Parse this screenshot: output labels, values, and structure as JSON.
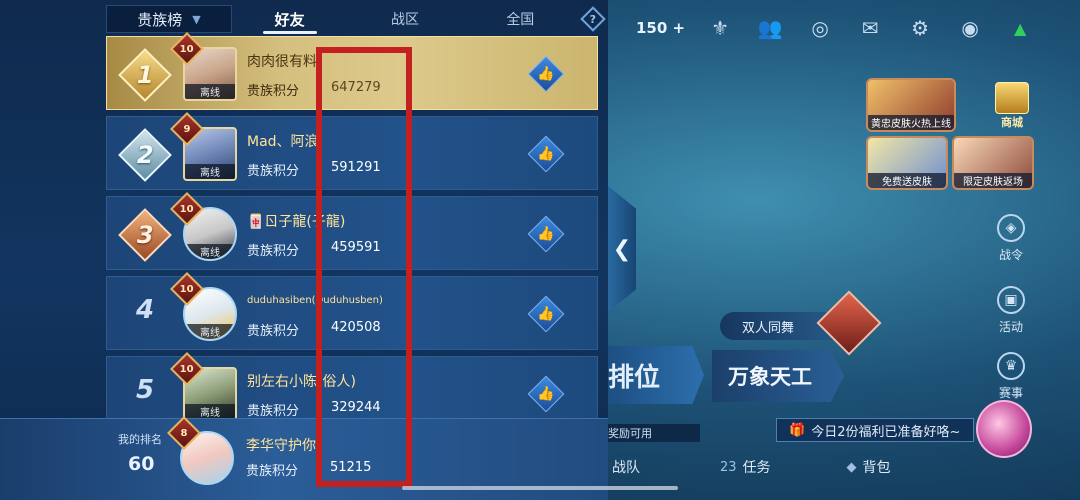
{
  "tabs": {
    "dropdown_label": "贵族榜",
    "friends": "好友",
    "region": "战区",
    "national": "全国",
    "help": "?"
  },
  "rows": [
    {
      "rank": "1",
      "level": "10",
      "name": "肉肉很有料",
      "score_label": "贵族积分",
      "score": "647279",
      "status": "离线"
    },
    {
      "rank": "2",
      "level": "9",
      "name": "Mad、阿浪",
      "score_label": "贵族积分",
      "score": "591291",
      "status": "离线"
    },
    {
      "rank": "3",
      "level": "10",
      "name": "🀄ㄖ子龍(子龍)",
      "score_label": "贵族积分",
      "score": "459591",
      "status": "离线"
    },
    {
      "rank": "4",
      "level": "10",
      "name": "duduhasiben(Duduhusben)",
      "score_label": "贵族积分",
      "score": "420508",
      "status": "离线"
    },
    {
      "rank": "5",
      "level": "10",
      "name": "别左右小陈(俗人)",
      "score_label": "贵族积分",
      "score": "329244",
      "status": "离线"
    }
  ],
  "my_rank": {
    "label": "我的排名",
    "value": "60",
    "level": "8",
    "name": "李华守护你",
    "score_label": "贵族积分",
    "score": "51215"
  },
  "game": {
    "currency": "150",
    "currency_plus": "+",
    "shop_card1": "黄忠皮肤火热上线",
    "shop_card2": "免费送皮肤",
    "shop_card3": "限定皮肤返场",
    "shop_label": "商城",
    "side_battlepass": "战令",
    "side_activity": "活动",
    "side_tournament": "赛事",
    "duo_label": "双人同舞",
    "mode_ranked": "排位",
    "mode_wanxiang": "万象天工",
    "reward_text": "奖励可用",
    "welfare_text": "今日2份福利已准备好咯~",
    "nav_team": "战队",
    "nav_tasks_count": "23",
    "nav_tasks": "任务",
    "nav_bag": "背包"
  },
  "colors": {
    "highlight_box": "#c42020",
    "first_row_gold": "#d5bf7e",
    "name_gold": "#ffe39a"
  },
  "icons": [
    "help-icon",
    "thumbs-up-icon",
    "chevron-left-icon",
    "currency-plus-icon",
    "rank-emblem-icon",
    "friends-icon",
    "target-icon",
    "mail-icon",
    "settings-gear-icon",
    "eye-icon",
    "wifi-signal-icon"
  ]
}
